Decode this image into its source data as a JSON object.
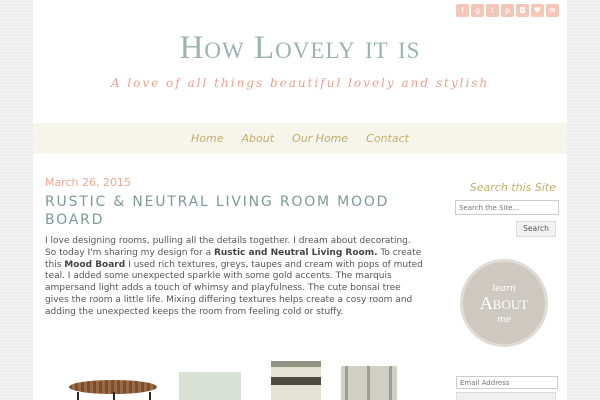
{
  "social_icons": [
    "facebook-icon",
    "google-plus-icon",
    "twitter-icon",
    "pinterest-icon",
    "instagram-icon",
    "heart-icon",
    "email-icon"
  ],
  "header": {
    "site_title": "How Lovely it is",
    "tagline": "A love of all things beautiful lovely and stylish"
  },
  "nav": {
    "items": [
      "Home",
      "About",
      "Our Home",
      "Contact"
    ]
  },
  "post": {
    "date": "March 26, 2015",
    "title": "Rustic & Neutral Living Room Mood Board",
    "body_1": "I love designing rooms, pulling all the details together. I dream about decorating. So today I'm sharing my design for a ",
    "body_bold_1": "Rustic and Neutral Living Room.",
    "body_2": " To create this ",
    "body_bold_2": "Mood Board",
    "body_3": " I used rich textures, greys, taupes and cream with pops of muted teal. I added some unexpected sparkle with some gold accents. The marquis ampersand light adds a touch of whimsy and playfulness. The cute bonsai tree gives the room a little life. Mixing differing textures helps create a cosy room and adding the unexpected keeps the room from feeling cold or stuffy."
  },
  "sidebar": {
    "search_title": "Search this Site",
    "search_placeholder": "Search the Site...",
    "search_button": "Search",
    "badge_line1": "learn",
    "badge_line2": "About",
    "badge_line3": "me",
    "email_placeholder": "Email Address"
  },
  "colors": {
    "title": "#9cb3ad",
    "accent_peach": "#f0a88e",
    "nav_gold": "#c4ad6a",
    "nav_bg": "#f5f5ec"
  }
}
